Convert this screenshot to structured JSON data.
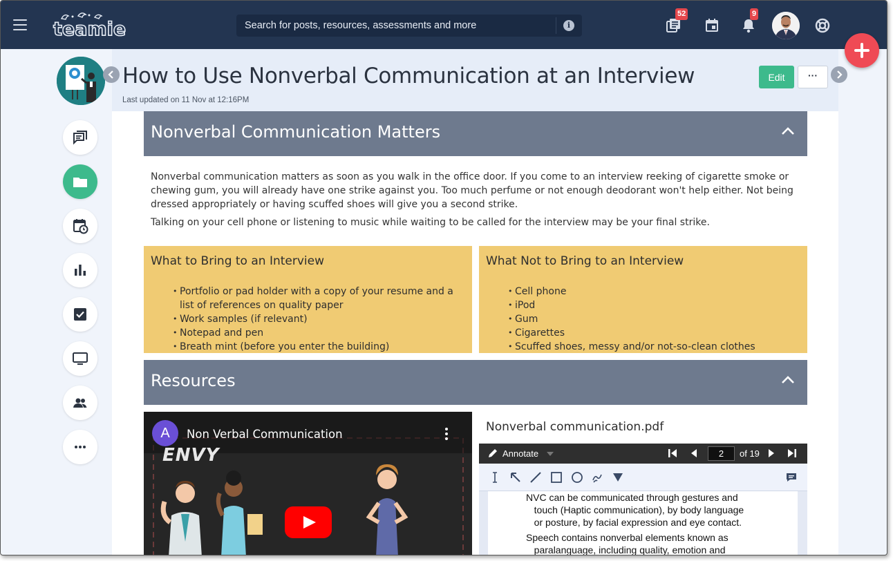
{
  "app": {
    "logo_text": "teamie",
    "search_placeholder": "Search for posts, resources, assessments and more",
    "badges": {
      "lessons": "52",
      "notifications": "9"
    }
  },
  "page": {
    "title": "How to Use Nonverbal Communication at an Interview",
    "last_updated": "Last updated on 11 Nov at 12:16PM",
    "edit_label": "Edit",
    "more_label": "···"
  },
  "sections": {
    "matters": {
      "title": "Nonverbal Communication Matters",
      "p1": "Nonverbal communication matters as soon as you walk in the office door. If you come to an interview reeking of cigarette smoke or chewing gum, you will already have one strike against you. Too much perfume or not enough deodorant won't help either. Not being dressed appropriately or having scuffed shoes will give you a second strike.",
      "p2": "Talking on your cell phone or listening to music while waiting to be called for the interview may be your final strike."
    },
    "bring": {
      "title": "What to Bring to an Interview",
      "items": [
        "Portfolio or pad holder with a copy of your resume and a list of references on quality paper",
        "Work samples (if relevant)",
        "Notepad and pen",
        "Breath mint (before you enter the building)"
      ]
    },
    "not_bring": {
      "title": "What Not to Bring to an Interview",
      "items": [
        "Cell phone",
        "iPod",
        "Gum",
        "Cigarettes",
        "Scuffed shoes, messy and/or not-so-clean clothes"
      ]
    },
    "resources": {
      "title": "Resources"
    }
  },
  "video": {
    "channel_initial": "A",
    "title": "Non Verbal Communication",
    "slate_word": "ENVY"
  },
  "pdf": {
    "filename": "Nonverbal communication.pdf",
    "annotate_label": "Annotate",
    "current_page": "2",
    "total_pages": "of 19",
    "lines": [
      "NVC can be communicated through gestures and",
      "   touch (Haptic communication), by body language",
      "   or posture, by facial expression and eye contact.",
      "Speech contains nonverbal elements known as",
      "   paralanguage, including quality, emotion and"
    ]
  },
  "colors": {
    "topbar": "#233551",
    "accent_green": "#3dba8c",
    "section_header": "#6e7a8e",
    "callout_box": "#f0cb73",
    "fab": "#ef4a55"
  }
}
